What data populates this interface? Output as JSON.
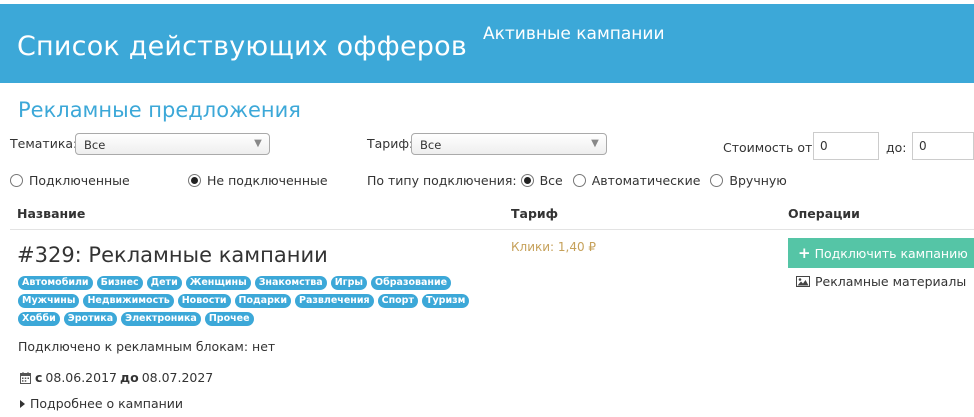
{
  "header": {
    "title": "Список действующих офферов",
    "subtitle": "Активные кампании"
  },
  "section_title": "Рекламные предложения",
  "filters": {
    "topic_label": "Тематика:",
    "topic_value": "Все",
    "tariff_label": "Тариф:",
    "tariff_value": "Все",
    "cost_from_label": "Стоимость от:",
    "cost_from_value": "0",
    "cost_to_label": "до:",
    "cost_to_value": "0"
  },
  "connection_filter": {
    "connected_label": "Подключенные",
    "not_connected_label": "Не подключенные",
    "selected": "not_connected"
  },
  "type_filter": {
    "label": "По типу подключения:",
    "options": [
      "Все",
      "Автоматические",
      "Вручную"
    ],
    "selected": "Все"
  },
  "table": {
    "columns": [
      "Название",
      "Тариф",
      "Операции"
    ]
  },
  "offer": {
    "title": "#329: Рекламные кампании",
    "tags_rows": [
      [
        "Автомобили",
        "Бизнес",
        "Дети",
        "Женщины",
        "Знакомства",
        "Игры",
        "Образование"
      ],
      [
        "Мужчины",
        "Недвижимость",
        "Новости",
        "Подарки",
        "Развлечения",
        "Спорт",
        "Туризм"
      ],
      [
        "Хобби",
        "Эротика",
        "Электроника",
        "Прочее"
      ]
    ],
    "connected_text": "Подключено к рекламным блокам: нет",
    "date_from_label": "с",
    "date_from": "08.06.2017",
    "date_to_label": "до",
    "date_to": "08.07.2027",
    "more_link": "Подробнее о кампании",
    "tariff": "Клики: 1,40 ₽",
    "connect_button": "Подключить кампанию",
    "materials_link": "Рекламные материалы"
  },
  "colors": {
    "header_bg": "#3ca8d8",
    "tag_bg": "#3ca8d8",
    "button_bg": "#55c5a6",
    "tariff_text": "#c6a15a"
  }
}
